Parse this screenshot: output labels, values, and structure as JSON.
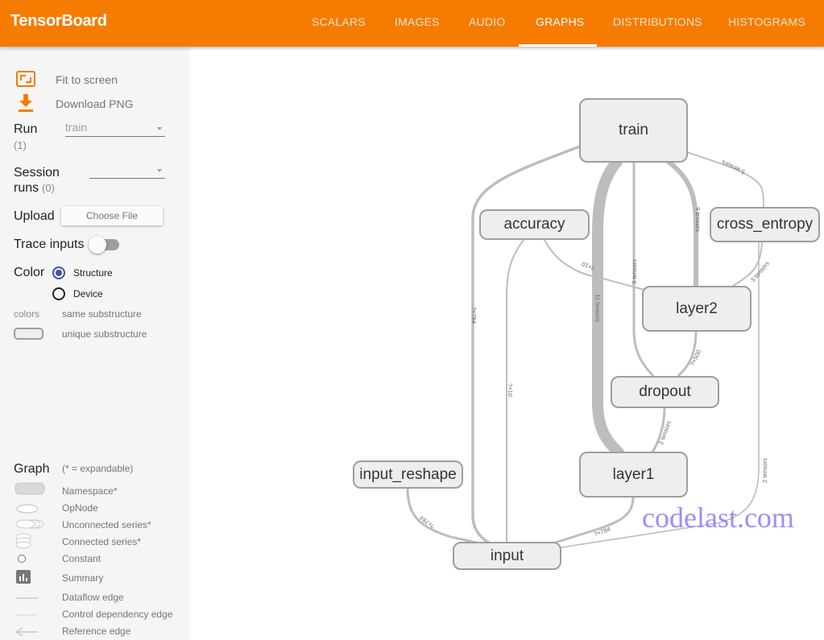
{
  "app": {
    "title": "TensorBoard",
    "accent_color": "#f57c00"
  },
  "tabs": [
    {
      "label": "SCALARS",
      "active": false
    },
    {
      "label": "IMAGES",
      "active": false
    },
    {
      "label": "AUDIO",
      "active": false
    },
    {
      "label": "GRAPHS",
      "active": true
    },
    {
      "label": "DISTRIBUTIONS",
      "active": false
    },
    {
      "label": "HISTOGRAMS",
      "active": false
    }
  ],
  "sidebar": {
    "fit_to_screen": "Fit to screen",
    "download_png": "Download PNG",
    "run_label": "Run",
    "run_count": "(1)",
    "run_value": "train",
    "session_label_1": "Session",
    "session_label_2": "runs",
    "session_count": "(0)",
    "session_value": "",
    "upload_label": "Upload",
    "choose_file": "Choose File",
    "trace_inputs": "Trace inputs",
    "trace_inputs_on": false,
    "color_label": "Color",
    "color_options": [
      {
        "label": "Structure",
        "selected": true
      },
      {
        "label": "Device",
        "selected": false
      }
    ],
    "colors_label": "colors",
    "same_substructure": "same substructure",
    "unique_substructure": "unique substructure"
  },
  "legend": {
    "title": "Graph",
    "subtitle": "(* = expandable)",
    "items": [
      {
        "icon": "namespace-icon",
        "label": "Namespace*"
      },
      {
        "icon": "opnode-icon",
        "label": "OpNode"
      },
      {
        "icon": "unconnected-series-icon",
        "label": "Unconnected series*"
      },
      {
        "icon": "connected-series-icon",
        "label": "Connected series*"
      },
      {
        "icon": "constant-icon",
        "label": "Constant"
      },
      {
        "icon": "summary-icon",
        "label": "Summary"
      },
      {
        "icon": "dataflow-edge-icon",
        "label": "Dataflow edge"
      },
      {
        "icon": "control-dependency-edge-icon",
        "label": "Control dependency edge"
      },
      {
        "icon": "reference-edge-icon",
        "label": "Reference edge"
      }
    ]
  },
  "graph": {
    "nodes": {
      "train": "train",
      "accuracy": "accuracy",
      "cross_entropy": "cross_entropy",
      "layer2": "layer2",
      "dropout": "dropout",
      "layer1": "layer1",
      "input_reshape": "input_reshape",
      "input": "input"
    },
    "edge_labels": {
      "train_cross_entropy": "5 tensors",
      "train_layer2": "9 tensors",
      "train_dropout": "9 tensors",
      "train_layer1": "11 tensors",
      "train_input": "?×784",
      "accuracy_layer2": "?×10",
      "accuracy_input": "?×10",
      "cross_entropy_layer2": "3 tensors",
      "layer2_dropout": "?×500",
      "dropout_layer1": "2 tensors",
      "cross_entropy_input": "2 tensors",
      "input_reshape_input": "?×784",
      "layer1_input": "?×784"
    }
  },
  "watermark": "codelast.com"
}
